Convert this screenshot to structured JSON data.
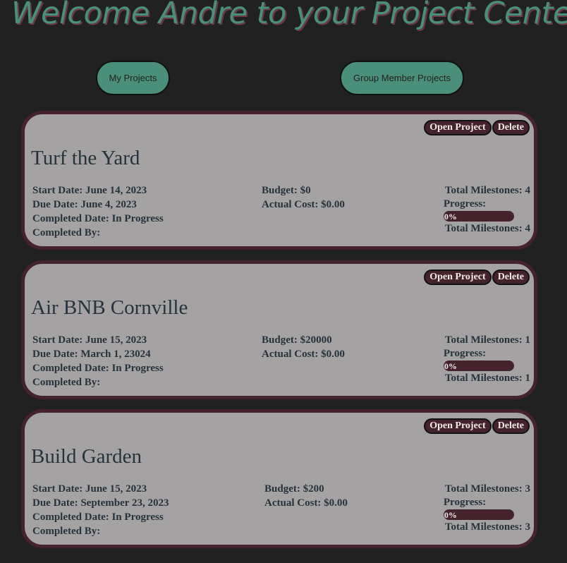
{
  "header": {
    "welcome": "Welcome Andre to your Project Center"
  },
  "nav": {
    "my_projects": "My Projects",
    "group_member_projects": "Group Member Projects"
  },
  "labels": {
    "open_project": "Open Project",
    "delete": "Delete"
  },
  "projects": [
    {
      "title": "Turf the Yard",
      "start_date": "Start Date: June 14, 2023",
      "due_date": "Due Date: June 4, 2023",
      "completed_date": "Completed Date: In Progress",
      "completed_by": "Completed By:",
      "budget": "Budget: $0",
      "actual_cost": "Actual Cost: $0.00",
      "total_milestones": "Total Milestones: 4",
      "progress_label": "Progress:",
      "progress_text": "0%",
      "progress_value": 0,
      "total_milestones_bottom": "Total Milestones: 4"
    },
    {
      "title": "Air BNB Cornville",
      "start_date": "Start Date: June 15, 2023",
      "due_date": "Due Date: March 1, 23024",
      "completed_date": "Completed Date: In Progress",
      "completed_by": "Completed By:",
      "budget": "Budget: $20000",
      "actual_cost": "Actual Cost: $0.00",
      "total_milestones": "Total Milestones: 1",
      "progress_label": "Progress:",
      "progress_text": "0%",
      "progress_value": 0,
      "total_milestones_bottom": "Total Milestones: 1"
    },
    {
      "title": "Build Garden",
      "start_date": "Start Date: June 15, 2023",
      "due_date": "Due Date: September 23, 2023",
      "completed_date": "Completed Date: In Progress",
      "completed_by": "Completed By:",
      "budget": "Budget: $200",
      "actual_cost": "Actual Cost: $0.00",
      "total_milestones": "Total Milestones: 3",
      "progress_label": "Progress:",
      "progress_text": "0%",
      "progress_value": 0,
      "total_milestones_bottom": "Total Milestones: 3"
    }
  ],
  "colors": {
    "background": "#212121",
    "accent_green": "#4a8f7a",
    "card_bg": "#a4a2a2",
    "card_border": "#44232c",
    "text_dark": "#27333b"
  }
}
